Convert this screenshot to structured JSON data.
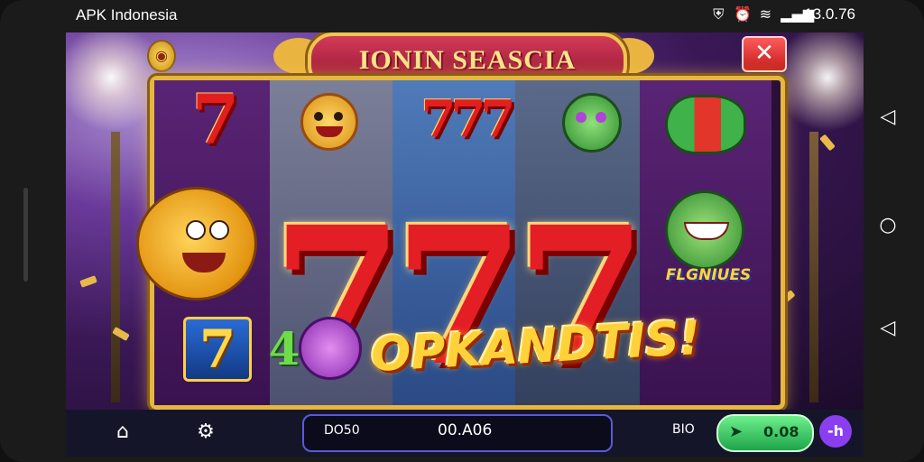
{
  "status_bar": {
    "app_title": "APK Indonesia",
    "time": "13.0.76",
    "icons": [
      "shield-icon",
      "alarm-icon",
      "wifi-icon",
      "signal-icon",
      "battery-icon"
    ]
  },
  "game": {
    "title": "IONIN SEASCIA",
    "close_symbol": "✕",
    "reels": {
      "top_row": [
        "7",
        "clown-face",
        "777",
        "green-face",
        "green-fish"
      ],
      "middle_row": [
        "golden-fish",
        "7",
        "7",
        "7",
        "green-dragon"
      ],
      "bottom_row": [
        "7-card",
        "40-purple-face",
        "OPKANDTIS!",
        "",
        ""
      ]
    },
    "big_sevens": [
      "7",
      "7",
      "7"
    ],
    "top_small_seven": "7",
    "triple_seven": "777",
    "bonus_text": "FLGNIUES",
    "win_text": "OPKANDTIS!",
    "small_seven_card": "7",
    "card_four": "4"
  },
  "bottom_bar": {
    "home_icon": "home-icon",
    "settings_icon": "settings-icon",
    "balance_label": "DO50",
    "balance_value": "00.A06",
    "bet_label": "BIO",
    "spin_value": "0.08",
    "menu_label": "-h"
  },
  "colors": {
    "accent_gold": "#e6b640",
    "seven_red": "#e41e25",
    "spin_green": "#1ea44a",
    "menu_purple": "#8b3ef0"
  }
}
